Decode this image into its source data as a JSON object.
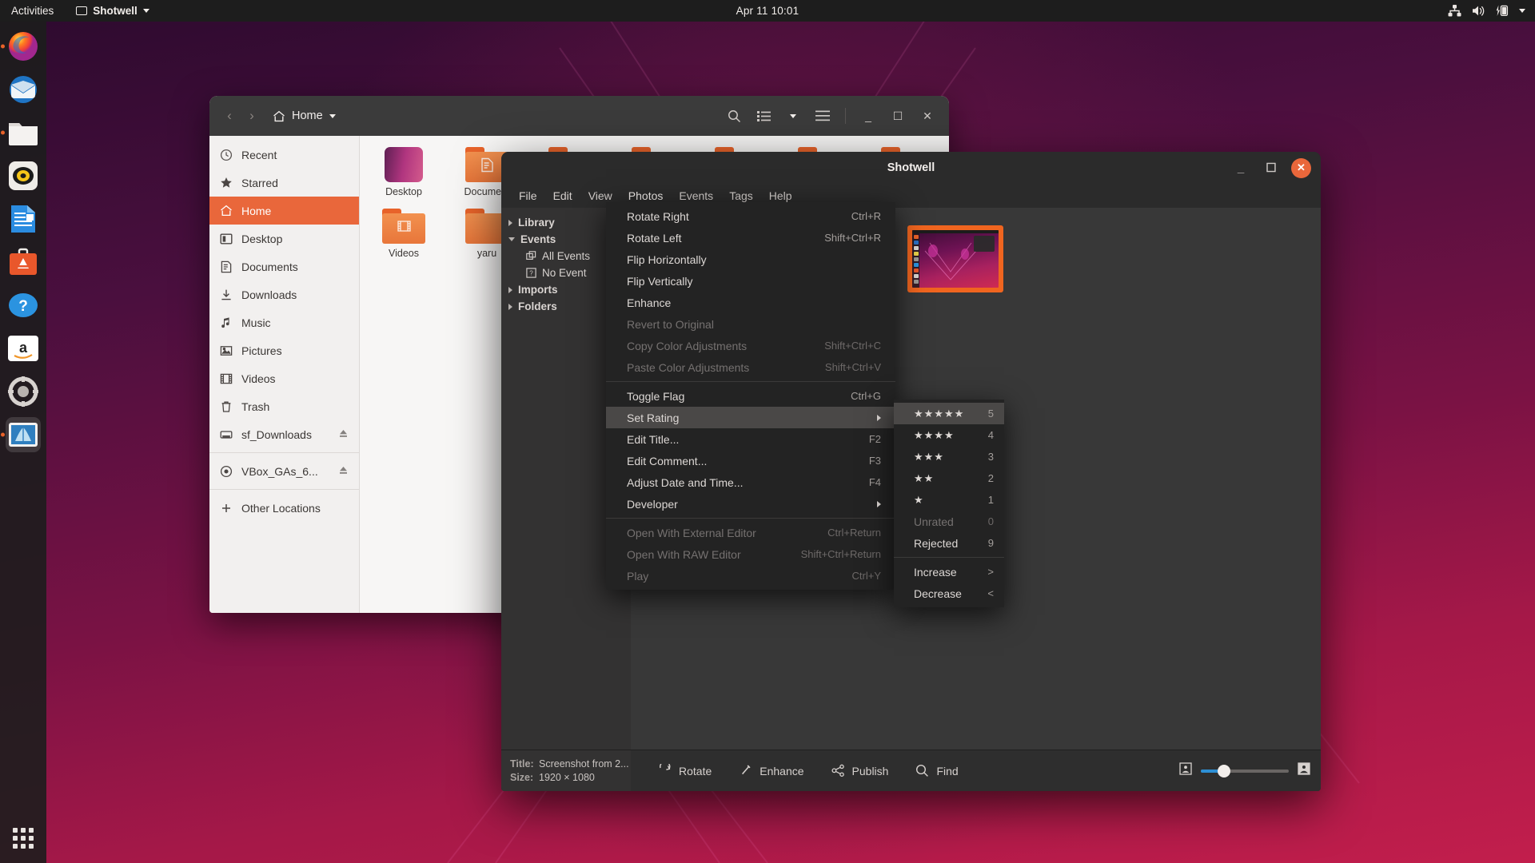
{
  "topbar": {
    "activities": "Activities",
    "app_name": "Shotwell",
    "clock": "Apr 11  10:01",
    "tray_icons": [
      "network-icon",
      "volume-icon",
      "battery-icon",
      "system-menu-caret-icon"
    ]
  },
  "dock": {
    "items": [
      {
        "name": "firefox",
        "label": "Firefox",
        "running": false
      },
      {
        "name": "thunderbird",
        "label": "Thunderbird",
        "running": false
      },
      {
        "name": "files",
        "label": "Files",
        "running": true
      },
      {
        "name": "rhythmbox",
        "label": "Rhythmbox",
        "running": false
      },
      {
        "name": "libreoffice-writer",
        "label": "LibreOffice Writer",
        "running": false
      },
      {
        "name": "ubuntu-software",
        "label": "Ubuntu Software",
        "running": false
      },
      {
        "name": "help",
        "label": "Help",
        "running": false
      },
      {
        "name": "amazon",
        "label": "Amazon",
        "running": false
      },
      {
        "name": "settings",
        "label": "Settings",
        "running": false
      },
      {
        "name": "shotwell",
        "label": "Shotwell",
        "running": true,
        "active": true
      }
    ],
    "show_apps_label": "Show Applications"
  },
  "files_window": {
    "title": "Home",
    "nav": {
      "back": "Back",
      "forward": "Forward"
    },
    "header_icons": [
      "search-icon",
      "list-view-icon",
      "chevron-down-icon",
      "hamburger-menu-icon"
    ],
    "window_controls": [
      "minimize",
      "maximize",
      "close"
    ],
    "sidebar": [
      {
        "label": "Recent",
        "icon": "clock-icon",
        "selected": false
      },
      {
        "label": "Starred",
        "icon": "star-icon",
        "selected": false
      },
      {
        "label": "Home",
        "icon": "home-icon",
        "selected": true
      },
      {
        "label": "Desktop",
        "icon": "desktop-icon",
        "selected": false
      },
      {
        "label": "Documents",
        "icon": "document-icon",
        "selected": false
      },
      {
        "label": "Downloads",
        "icon": "download-icon",
        "selected": false
      },
      {
        "label": "Music",
        "icon": "music-note-icon",
        "selected": false
      },
      {
        "label": "Pictures",
        "icon": "picture-icon",
        "selected": false
      },
      {
        "label": "Videos",
        "icon": "film-icon",
        "selected": false
      },
      {
        "label": "Trash",
        "icon": "trash-icon",
        "selected": false
      },
      {
        "label": "sf_Downloads",
        "icon": "drive-icon",
        "selected": false,
        "eject": true
      },
      {
        "label": "VBox_GAs_6...",
        "icon": "disc-icon",
        "selected": false,
        "eject": true,
        "separator_before": true
      },
      {
        "label": "Other Locations",
        "icon": "plus-icon",
        "selected": false,
        "separator_before": true
      }
    ],
    "files_row1": [
      {
        "label": "Desktop",
        "type": "desktop-thumb"
      },
      {
        "label": "Docume...",
        "type": "folder",
        "glyph": "document"
      },
      {
        "label": "",
        "type": "folder",
        "glyph": "download"
      },
      {
        "label": "",
        "type": "folder",
        "glyph": "music"
      },
      {
        "label": "",
        "type": "folder",
        "glyph": "picture"
      },
      {
        "label": "",
        "type": "folder",
        "glyph": "public"
      },
      {
        "label": "",
        "type": "folder",
        "glyph": "templates"
      }
    ],
    "files_row2": [
      {
        "label": "Videos",
        "type": "folder",
        "glyph": "film"
      },
      {
        "label": "yaru",
        "type": "folder",
        "glyph": "plain"
      }
    ]
  },
  "shotwell": {
    "title": "Shotwell",
    "window_controls": [
      "minimize",
      "maximize",
      "close"
    ],
    "menubar": [
      {
        "label": "File",
        "open": false
      },
      {
        "label": "Edit",
        "open": false
      },
      {
        "label": "View",
        "open": false
      },
      {
        "label": "Photos",
        "open": true
      },
      {
        "label": "Events",
        "open": false
      },
      {
        "label": "Tags",
        "open": false
      },
      {
        "label": "Help",
        "open": false
      }
    ],
    "sidebar": [
      {
        "label": "Library",
        "level": 0,
        "expander": "right",
        "bold": true
      },
      {
        "label": "Events",
        "level": 0,
        "expander": "down",
        "bold": true
      },
      {
        "label": "All Events",
        "level": 1,
        "icon": "events-icon",
        "bold": false
      },
      {
        "label": "No Event",
        "level": 1,
        "icon": "no-event-icon",
        "bold": false
      },
      {
        "label": "Imports",
        "level": 0,
        "expander": "right",
        "bold": true
      },
      {
        "label": "Folders",
        "level": 0,
        "expander": "right",
        "bold": true
      }
    ],
    "thumbnails": [
      {
        "name": "thumbnail-1",
        "selected": false,
        "variant": "plain"
      },
      {
        "name": "thumbnail-2",
        "selected": false,
        "variant": "dialog"
      },
      {
        "name": "thumbnail-3",
        "selected": true,
        "variant": "panel"
      }
    ],
    "metadata": {
      "title_label": "Title:",
      "title_value": "Screenshot from 2...",
      "size_label": "Size:",
      "size_value": "1920 × 1080"
    },
    "toolbar": [
      {
        "label": "Rotate",
        "icon": "rotate-icon"
      },
      {
        "label": "Enhance",
        "icon": "wand-icon"
      },
      {
        "label": "Publish",
        "icon": "share-icon"
      },
      {
        "label": "Find",
        "icon": "search-icon"
      }
    ],
    "zoom": {
      "min_icon": "zoom-out-thumb-icon",
      "max_icon": "zoom-in-thumb-icon",
      "value": 22
    }
  },
  "photos_menu": {
    "items": [
      {
        "label": "Rotate Right",
        "shortcut": "Ctrl+R",
        "disabled": false
      },
      {
        "label": "Rotate Left",
        "shortcut": "Shift+Ctrl+R",
        "disabled": false
      },
      {
        "label": "Flip Horizontally",
        "shortcut": "",
        "disabled": false
      },
      {
        "label": "Flip Vertically",
        "shortcut": "",
        "disabled": false
      },
      {
        "label": "Enhance",
        "shortcut": "",
        "disabled": false
      },
      {
        "label": "Revert to Original",
        "shortcut": "",
        "disabled": true
      },
      {
        "label": "Copy Color Adjustments",
        "shortcut": "Shift+Ctrl+C",
        "disabled": true
      },
      {
        "label": "Paste Color Adjustments",
        "shortcut": "Shift+Ctrl+V",
        "disabled": true
      },
      {
        "separator": true
      },
      {
        "label": "Toggle Flag",
        "shortcut": "Ctrl+G",
        "disabled": false
      },
      {
        "label": "Set Rating",
        "submenu": true,
        "highlighted": true,
        "disabled": false
      },
      {
        "label": "Edit Title...",
        "shortcut": "F2",
        "disabled": false
      },
      {
        "label": "Edit Comment...",
        "shortcut": "F3",
        "disabled": false
      },
      {
        "label": "Adjust Date and Time...",
        "shortcut": "F4",
        "disabled": false
      },
      {
        "label": "Developer",
        "submenu": true,
        "disabled": false
      },
      {
        "separator": true
      },
      {
        "label": "Open With External Editor",
        "shortcut": "Ctrl+Return",
        "disabled": true
      },
      {
        "label": "Open With RAW Editor",
        "shortcut": "Shift+Ctrl+Return",
        "disabled": true
      },
      {
        "label": "Play",
        "shortcut": "Ctrl+Y",
        "disabled": true
      }
    ]
  },
  "rating_submenu": {
    "items": [
      {
        "label": "★★★★★",
        "shortcut": "5",
        "highlighted": true,
        "disabled": false,
        "stars": true
      },
      {
        "label": "★★★★",
        "shortcut": "4",
        "disabled": false,
        "stars": true
      },
      {
        "label": "★★★",
        "shortcut": "3",
        "disabled": false,
        "stars": true
      },
      {
        "label": "★★",
        "shortcut": "2",
        "disabled": false,
        "stars": true
      },
      {
        "label": "★",
        "shortcut": "1",
        "disabled": false,
        "stars": true
      },
      {
        "label": "Unrated",
        "shortcut": "0",
        "disabled": true
      },
      {
        "label": "Rejected",
        "shortcut": "9",
        "disabled": false
      },
      {
        "separator": true
      },
      {
        "label": "Increase",
        "shortcut": ">",
        "disabled": false
      },
      {
        "label": "Decrease",
        "shortcut": "<",
        "disabled": false
      }
    ]
  },
  "colors": {
    "accent_orange": "#e8622a",
    "selection_orange": "#f0651f",
    "topbar_bg": "#1d1d1d",
    "menu_bg": "#232323",
    "slider_blue": "#2d8fd5"
  }
}
